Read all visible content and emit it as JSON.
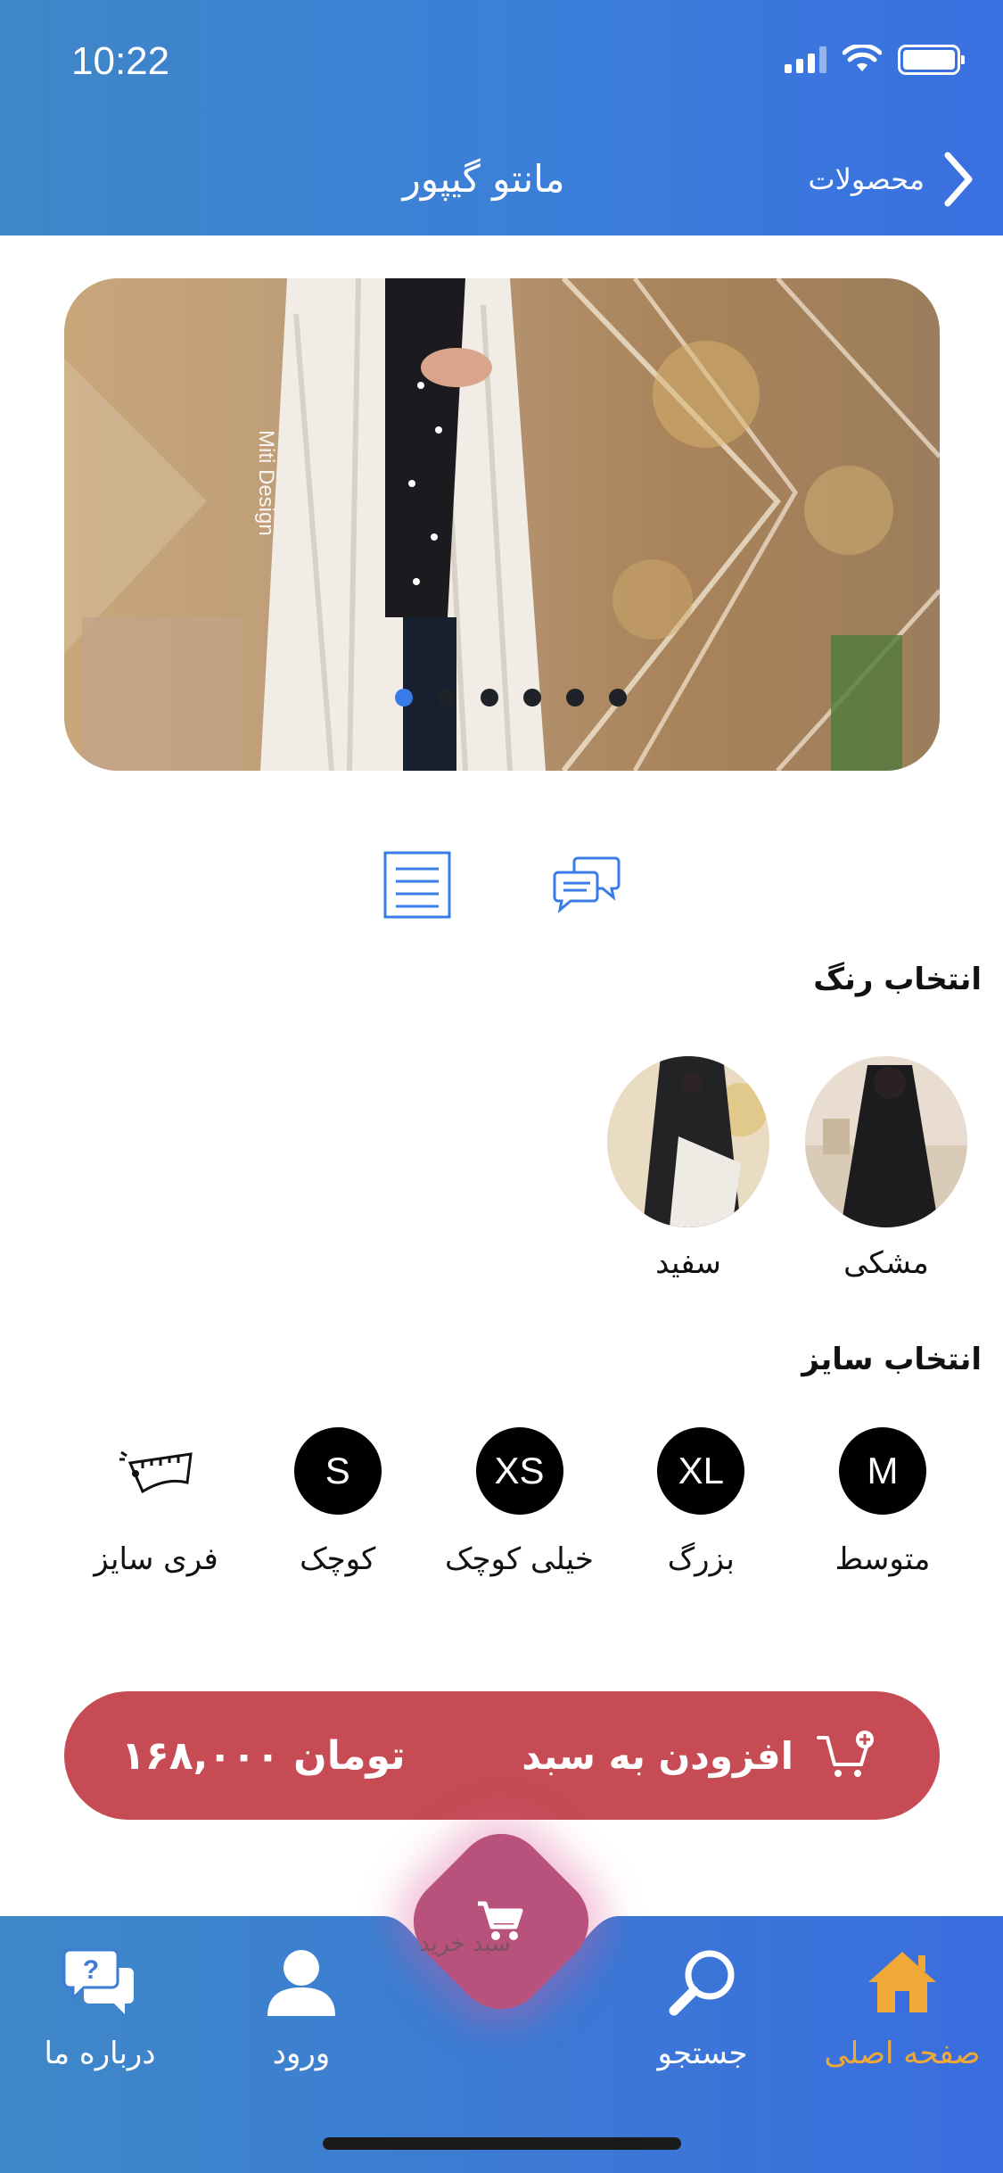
{
  "status_bar": {
    "time": "10:22"
  },
  "header": {
    "title": "مانتو گیپور",
    "back_label": "محصولات"
  },
  "carousel": {
    "watermark": "Miti Design",
    "slide_count": 6,
    "active_index": 0
  },
  "color_section": {
    "title": "انتخاب رنگ",
    "options": [
      {
        "label": "مشکی"
      },
      {
        "label": "سفید"
      }
    ]
  },
  "size_section": {
    "title": "انتخاب سایز",
    "options": [
      {
        "badge": "M",
        "label": "متوسط"
      },
      {
        "badge": "XL",
        "label": "بزرگ"
      },
      {
        "badge": "XS",
        "label": "خیلی کوچک"
      },
      {
        "badge": "S",
        "label": "کوچک"
      },
      {
        "badge": "",
        "label": "فری سایز",
        "icon": "tape-measure-icon"
      }
    ]
  },
  "cart_button": {
    "label": "افزودن به سبد",
    "price": "۱۶۸,۰۰۰ تومان"
  },
  "bottom_nav": {
    "items": [
      {
        "label": "صفحه اصلی",
        "icon": "home-icon",
        "active": true
      },
      {
        "label": "جستجو",
        "icon": "search-icon",
        "active": false
      },
      {
        "label": "سبد خرید",
        "icon": "cart-icon",
        "active": false
      },
      {
        "label": "ورود",
        "icon": "user-icon",
        "active": false
      },
      {
        "label": "درباره ما",
        "icon": "chat-question-icon",
        "active": false
      }
    ]
  },
  "colors": {
    "header": "#3b7fd9",
    "cart_button": "#c64b55",
    "active_nav": "#f0a836",
    "active_dot": "#3a7bea",
    "fab": "#b9517d"
  }
}
